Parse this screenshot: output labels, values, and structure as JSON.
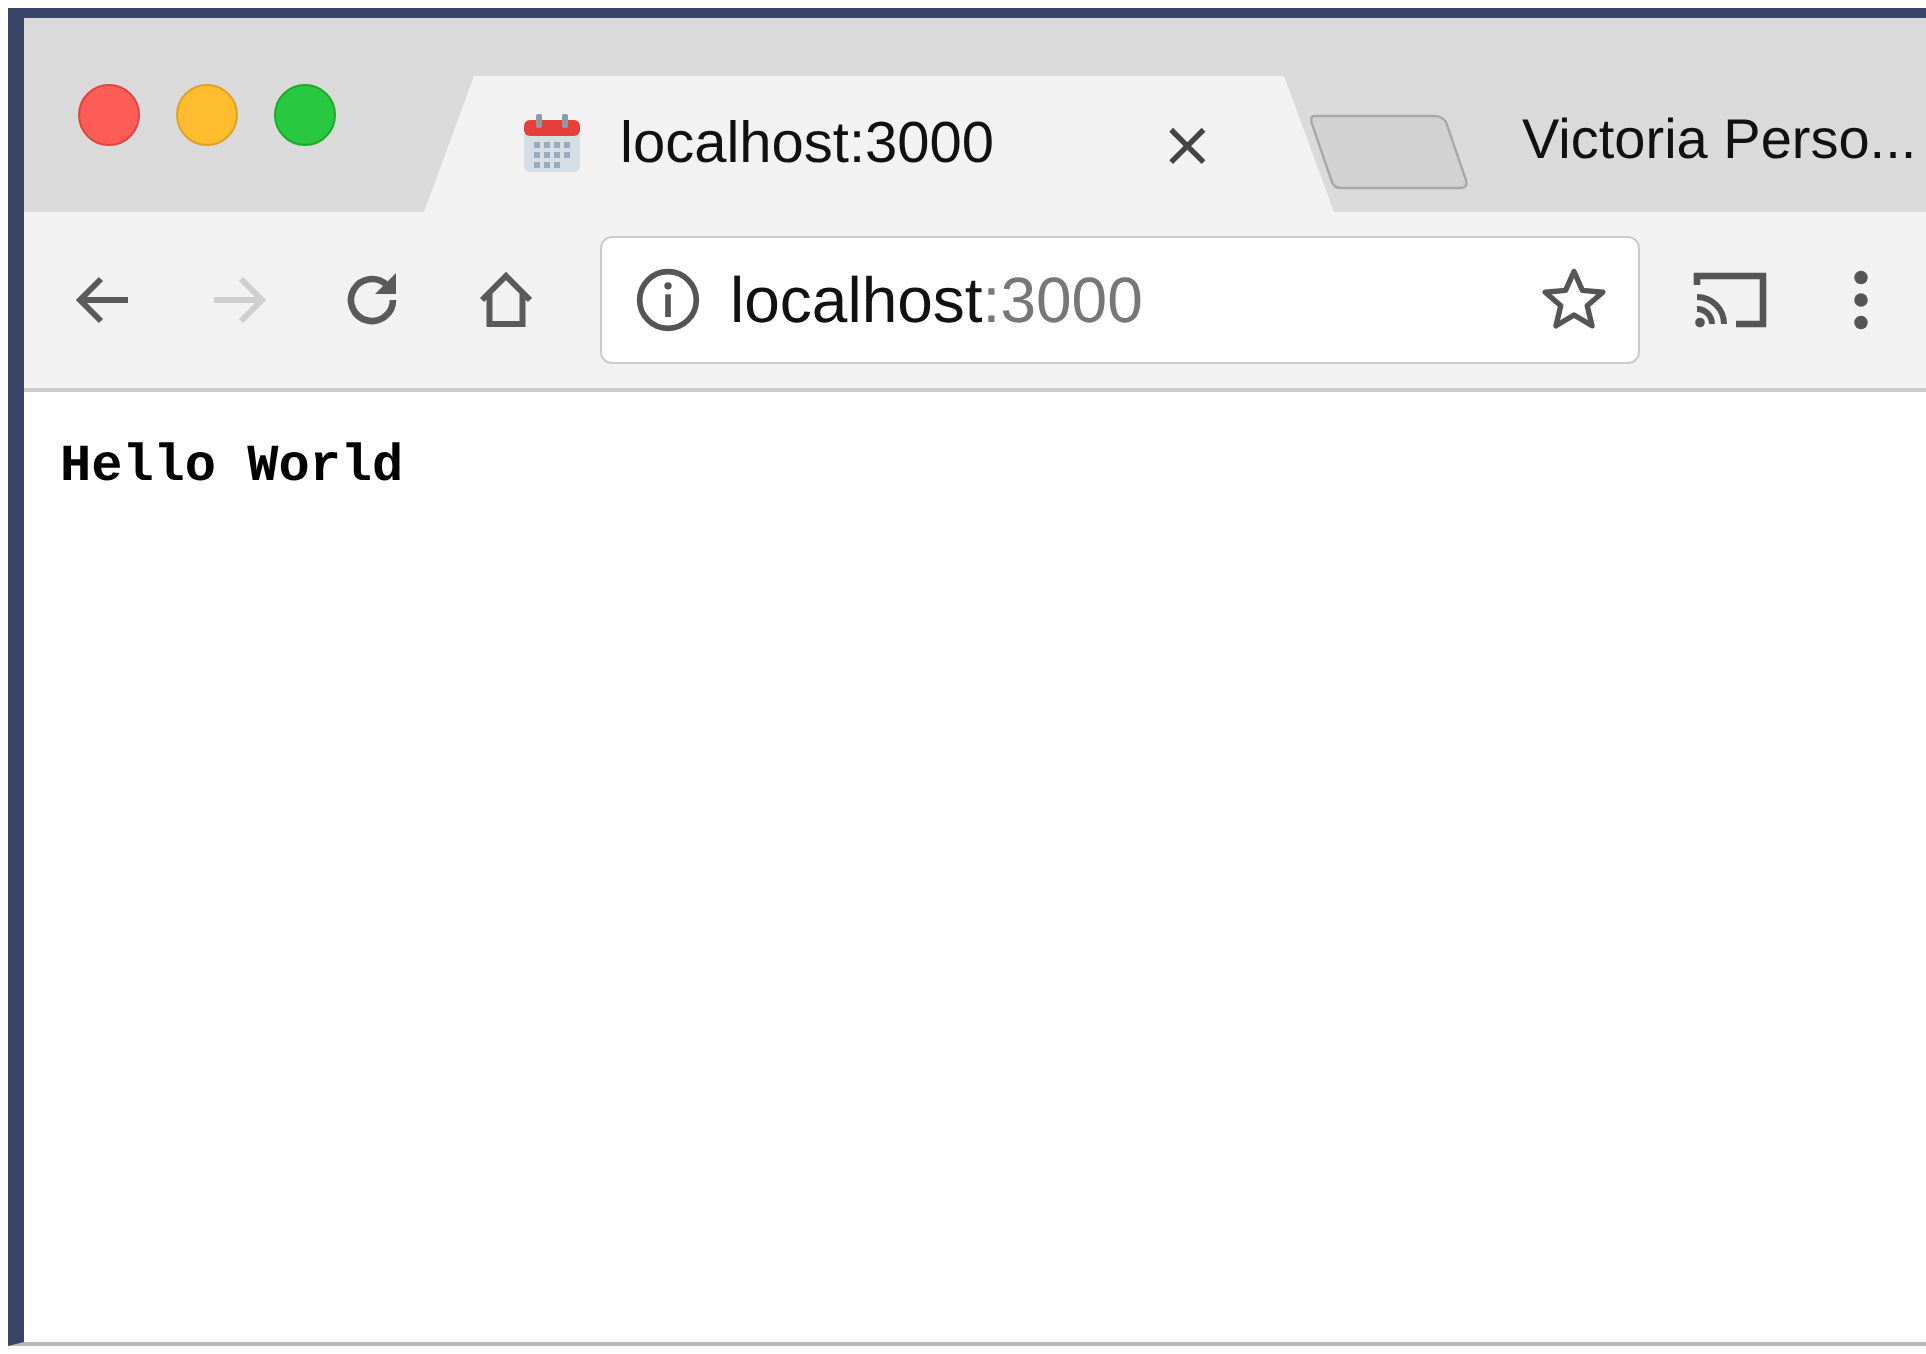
{
  "tabs": [
    {
      "title": "localhost:3000",
      "close": "×",
      "selected": true
    }
  ],
  "profile": "Victoria Perso...",
  "toolbar": {
    "back_disabled": false,
    "forward_disabled": true
  },
  "address": {
    "host": "localhost",
    "port": ":3000"
  },
  "page": {
    "text": "Hello World"
  }
}
